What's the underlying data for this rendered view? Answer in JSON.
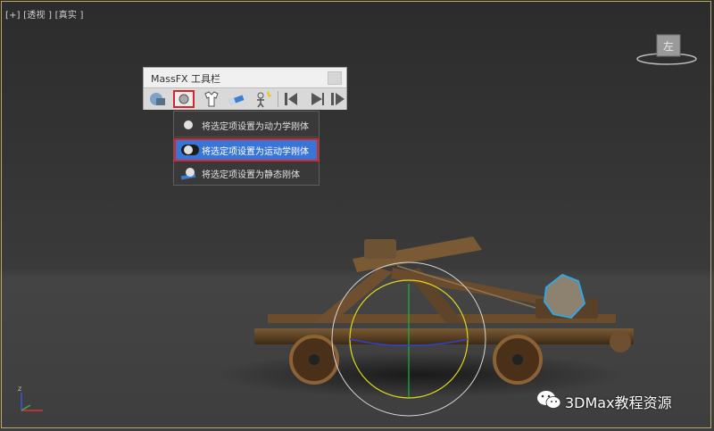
{
  "viewport": {
    "label_plus": "[+]",
    "label_view": "[透视 ]",
    "label_shading": "[真实 ]"
  },
  "toolbar": {
    "title": "MassFX 工具栏",
    "buttons": [
      "world-parameters-icon",
      "rigid-body-icon",
      "cloth-icon",
      "constraint-icon",
      "ragdoll-icon",
      "reset-sim-icon",
      "play-sim-icon",
      "step-sim-icon"
    ]
  },
  "rigid_menu": {
    "items": [
      {
        "label": "将选定项设置为动力学刚体",
        "icon": "dynamic-sphere-icon"
      },
      {
        "label": "将选定项设置为运动学刚体",
        "icon": "kinematic-sphere-icon",
        "highlighted": true
      },
      {
        "label": "将选定项设置为静态刚体",
        "icon": "static-sphere-icon"
      }
    ]
  },
  "viewcube": {
    "face_label": "左"
  },
  "axis": {
    "z_label": "z"
  },
  "watermark": {
    "text": "3DMax教程资源"
  },
  "colors": {
    "highlight": "#3875d7",
    "callout_red": "#d7262b",
    "viewport_border": "#b8a96b"
  }
}
